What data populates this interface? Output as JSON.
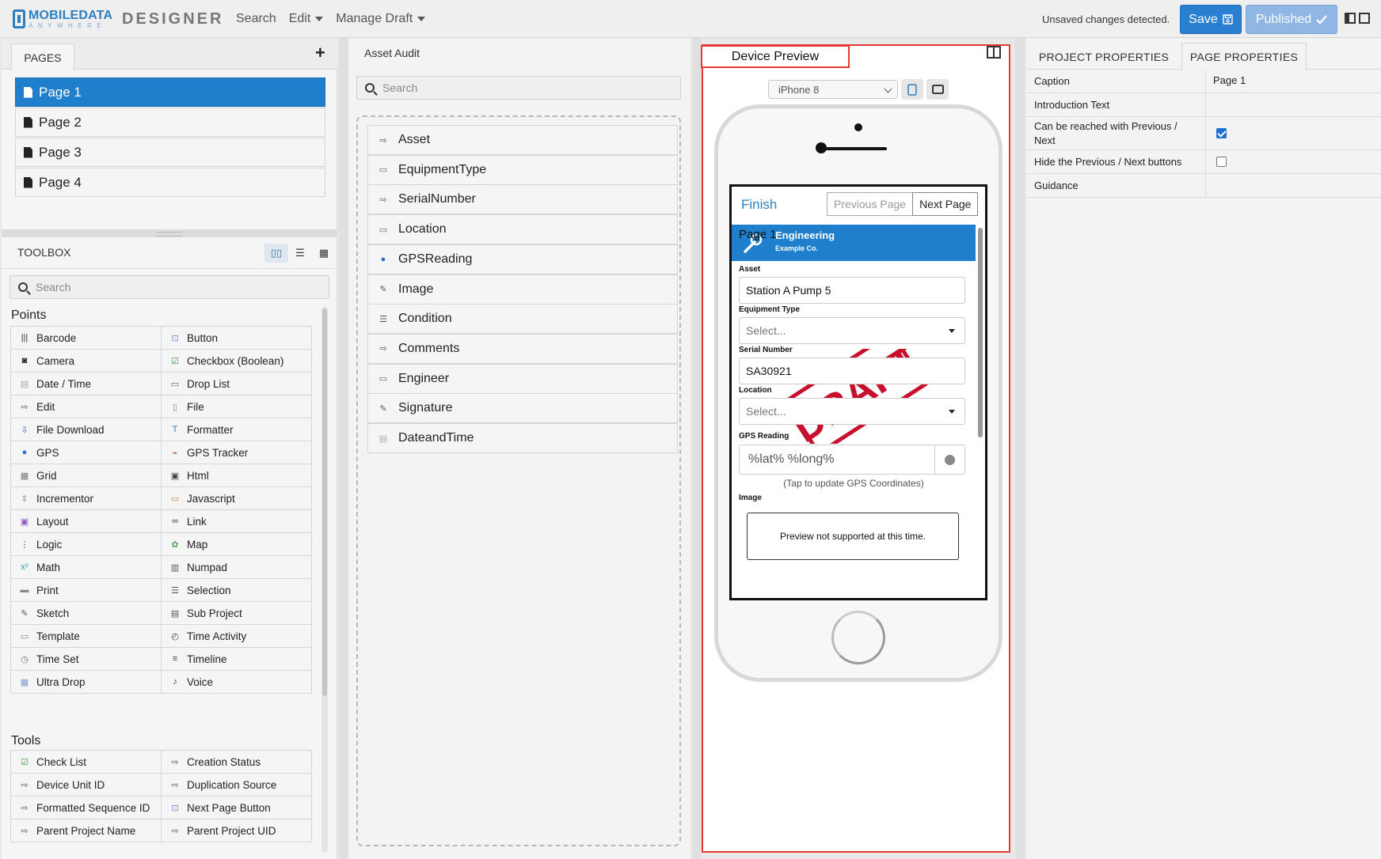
{
  "app": {
    "logo_main_a": "MOBILE",
    "logo_main_b": "DATA",
    "logo_sub": "ANYWHERE",
    "name": "DESIGNER",
    "nav": {
      "search": "Search",
      "edit": "Edit",
      "manage": "Manage Draft"
    },
    "status": "Unsaved changes detected.",
    "save_label": "Save",
    "published_label": "Published",
    "accent": "#1f7fcc"
  },
  "pages": {
    "tab_label": "PAGES",
    "items": [
      "Page 1",
      "Page 2",
      "Page 3",
      "Page 4"
    ],
    "active_index": 0
  },
  "toolbox": {
    "title": "TOOLBOX",
    "search_placeholder": "Search",
    "points_label": "Points",
    "points": [
      {
        "label": "Barcode",
        "icon": "barcode-icon"
      },
      {
        "label": "Button",
        "icon": "button-icon"
      },
      {
        "label": "Camera",
        "icon": "camera-icon"
      },
      {
        "label": "Checkbox (Boolean)",
        "icon": "checkbox-icon"
      },
      {
        "label": "Date / Time",
        "icon": "calendar-icon"
      },
      {
        "label": "Drop List",
        "icon": "droplist-icon"
      },
      {
        "label": "Edit",
        "icon": "edit-icon"
      },
      {
        "label": "File",
        "icon": "file-icon"
      },
      {
        "label": "File Download",
        "icon": "download-icon"
      },
      {
        "label": "Formatter",
        "icon": "formatter-icon"
      },
      {
        "label": "GPS",
        "icon": "gps-pin-icon"
      },
      {
        "label": "GPS Tracker",
        "icon": "gps-tracker-icon"
      },
      {
        "label": "Grid",
        "icon": "grid-icon"
      },
      {
        "label": "Html",
        "icon": "html-icon"
      },
      {
        "label": "Incrementor",
        "icon": "incrementor-icon"
      },
      {
        "label": "Javascript",
        "icon": "javascript-icon"
      },
      {
        "label": "Layout",
        "icon": "layout-icon"
      },
      {
        "label": "Link",
        "icon": "link-icon"
      },
      {
        "label": "Logic",
        "icon": "logic-icon"
      },
      {
        "label": "Map",
        "icon": "map-icon"
      },
      {
        "label": "Math",
        "icon": "math-icon"
      },
      {
        "label": "Numpad",
        "icon": "numpad-icon"
      },
      {
        "label": "Print",
        "icon": "print-icon"
      },
      {
        "label": "Selection",
        "icon": "selection-icon"
      },
      {
        "label": "Sketch",
        "icon": "sketch-icon"
      },
      {
        "label": "Sub Project",
        "icon": "sub-project-icon"
      },
      {
        "label": "Template",
        "icon": "template-icon"
      },
      {
        "label": "Time Activity",
        "icon": "time-activity-icon"
      },
      {
        "label": "Time Set",
        "icon": "clock-icon"
      },
      {
        "label": "Timeline",
        "icon": "timeline-icon"
      },
      {
        "label": "Ultra Drop",
        "icon": "ultra-drop-icon"
      },
      {
        "label": "Voice",
        "icon": "microphone-icon"
      }
    ],
    "tools_label": "Tools",
    "tools": [
      {
        "label": "Check List",
        "icon": "checklist-icon"
      },
      {
        "label": "Creation Status",
        "icon": "edit-icon"
      },
      {
        "label": "Device Unit ID",
        "icon": "edit-icon"
      },
      {
        "label": "Duplication Source",
        "icon": "edit-icon"
      },
      {
        "label": "Formatted Sequence ID",
        "icon": "edit-icon"
      },
      {
        "label": "Next Page Button",
        "icon": "button-icon"
      },
      {
        "label": "Parent Project Name",
        "icon": "edit-icon"
      },
      {
        "label": "Parent Project UID",
        "icon": "edit-icon"
      }
    ]
  },
  "audit": {
    "title": "Asset Audit",
    "search_placeholder": "Search",
    "fields": [
      {
        "label": "Asset",
        "icon": "edit-icon"
      },
      {
        "label": "EquipmentType",
        "icon": "droplist-icon"
      },
      {
        "label": "SerialNumber",
        "icon": "edit-icon"
      },
      {
        "label": "Location",
        "icon": "droplist-icon"
      },
      {
        "label": "GPSReading",
        "icon": "gps-pin-icon"
      },
      {
        "label": "Image",
        "icon": "sketch-icon"
      },
      {
        "label": "Condition",
        "icon": "selection-icon"
      },
      {
        "label": "Comments",
        "icon": "edit-icon"
      },
      {
        "label": "Engineer",
        "icon": "droplist-icon"
      },
      {
        "label": "Signature",
        "icon": "sketch-icon"
      },
      {
        "label": "DateandTime",
        "icon": "calendar-icon"
      }
    ]
  },
  "preview": {
    "tab_label": "Device Preview",
    "device": "iPhone 8",
    "finish": "Finish",
    "prev": "Previous Page",
    "next": "Next Page",
    "page_label": "Page 1",
    "org_name": "Engineering",
    "org_sub": "Example Co.",
    "asset_label": "Asset",
    "asset_value": "Station A Pump 5",
    "equip_label": "Equipment Type",
    "select_ph": "Select...",
    "serial_label": "Serial Number",
    "serial_value": "SA30921",
    "location_label": "Location",
    "gps_label": "GPS Reading",
    "gps_value": "%lat% %long%",
    "gps_hint": "(Tap to update GPS Coordinates)",
    "image_label": "Image",
    "image_msg": "Preview not supported at this time.",
    "draft_text": "DRAFT"
  },
  "properties": {
    "tab_project": "PROJECT PROPERTIES",
    "tab_page": "PAGE PROPERTIES",
    "rows": [
      {
        "key": "Caption",
        "value": "Page 1"
      },
      {
        "key": "Introduction Text",
        "value": ""
      },
      {
        "key": "Can be reached with Previous / Next",
        "checked": true
      },
      {
        "key": "Hide the Previous / Next buttons",
        "checked": false
      },
      {
        "key": "Guidance",
        "value": ""
      }
    ]
  }
}
